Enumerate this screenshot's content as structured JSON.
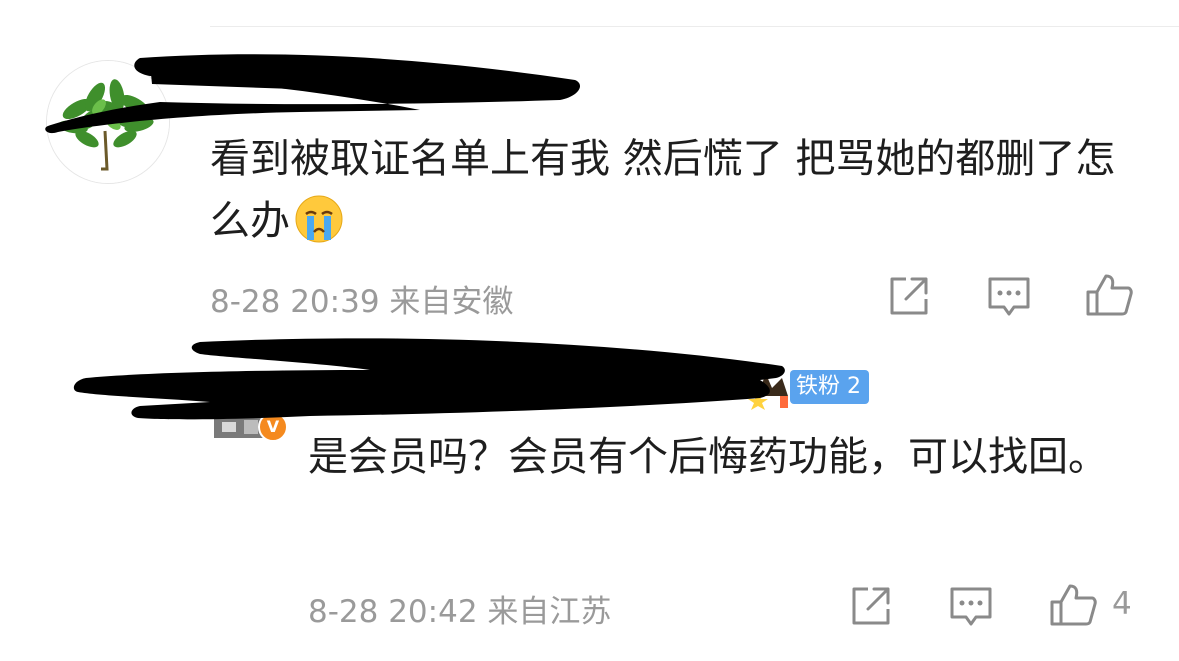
{
  "comments": [
    {
      "text": "看到被取证名单上有我 然后慌了 把骂她的都删了怎么办",
      "emoji": "crying-face",
      "date": "8-28 20:39",
      "location": "来自安徽",
      "like_count": ""
    },
    {
      "fan_badge": "铁粉 2",
      "verified_mark": "V",
      "text": "是会员吗？会员有个后悔药功能，可以找回。",
      "date": "8-28 20:42",
      "location": "来自江苏",
      "like_count": "4"
    }
  ],
  "icons": {
    "share": "share-icon",
    "comment": "comment-icon",
    "like": "thumbs-up-icon"
  },
  "colors": {
    "meta_text": "#9a9a9a",
    "fan_badge": "#5aa3ee",
    "verified": "#f58a1f"
  }
}
